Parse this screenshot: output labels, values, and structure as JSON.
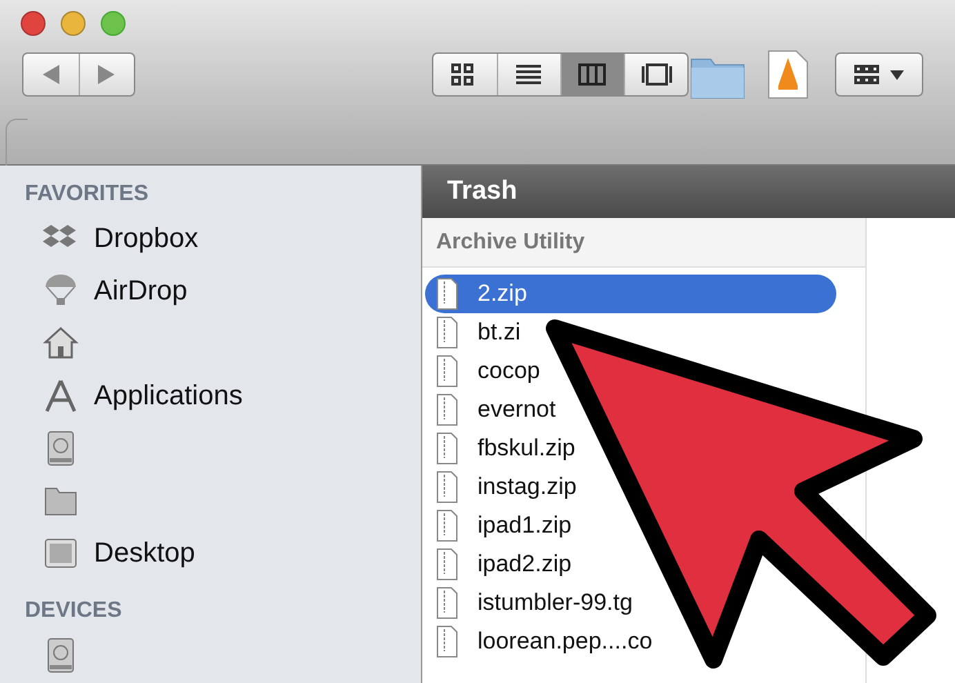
{
  "toolbar": {
    "view_buttons": [
      {
        "kind": "icon",
        "selected": false
      },
      {
        "kind": "list",
        "selected": false
      },
      {
        "kind": "column",
        "selected": true
      },
      {
        "kind": "coverflow",
        "selected": false
      }
    ]
  },
  "sidebar": {
    "sections": [
      {
        "title": "FAVORITES",
        "items": [
          {
            "kind": "dropbox",
            "label": "Dropbox"
          },
          {
            "kind": "airdrop",
            "label": "AirDrop"
          },
          {
            "kind": "home"
          },
          {
            "kind": "apps",
            "label": "Applications"
          },
          {
            "kind": "disk"
          },
          {
            "kind": "folder"
          },
          {
            "kind": "desktop",
            "label": "Desktop"
          }
        ]
      },
      {
        "title": "DEVICES",
        "items": [
          {
            "kind": "disk"
          }
        ]
      }
    ]
  },
  "column": {
    "title": "Trash",
    "parent": "Archive Utility",
    "files": [
      {
        "name": "2.zip",
        "selected": true
      },
      {
        "name": "bt.zi",
        "selected": false
      },
      {
        "name": "cocop",
        "selected": false
      },
      {
        "name": "evernot",
        "selected": false
      },
      {
        "name": "fbskul.zip",
        "selected": false
      },
      {
        "name": "instag.zip",
        "selected": false
      },
      {
        "name": "ipad1.zip",
        "selected": false
      },
      {
        "name": "ipad2.zip",
        "selected": false
      },
      {
        "name": "istumbler-99.tg",
        "selected": false
      },
      {
        "name": "loorean.pep....co",
        "selected": false
      }
    ]
  }
}
